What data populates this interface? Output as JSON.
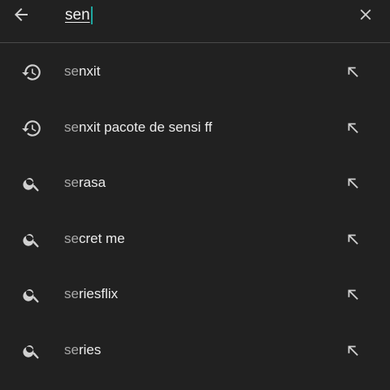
{
  "search": {
    "query": "sen"
  },
  "suggestions": [
    {
      "type": "history",
      "prefix": "se",
      "rest": "nxit"
    },
    {
      "type": "history",
      "prefix": "se",
      "rest": "nxit pacote de sensi ff"
    },
    {
      "type": "search",
      "prefix": "se",
      "rest": "rasa"
    },
    {
      "type": "search",
      "prefix": "se",
      "rest": "cret me"
    },
    {
      "type": "search",
      "prefix": "se",
      "rest": "riesflix"
    },
    {
      "type": "search",
      "prefix": "se",
      "rest": "ries"
    }
  ],
  "icons": {
    "back": "arrow-left-icon",
    "clear": "close-icon",
    "history": "history-icon",
    "search": "search-icon",
    "fill": "arrow-up-left-icon"
  },
  "colors": {
    "background": "#212121",
    "caret": "#1ea7a0",
    "text": "#ececec",
    "matched_prefix": "#a8a8a8",
    "icon": "#d0d0d0"
  }
}
